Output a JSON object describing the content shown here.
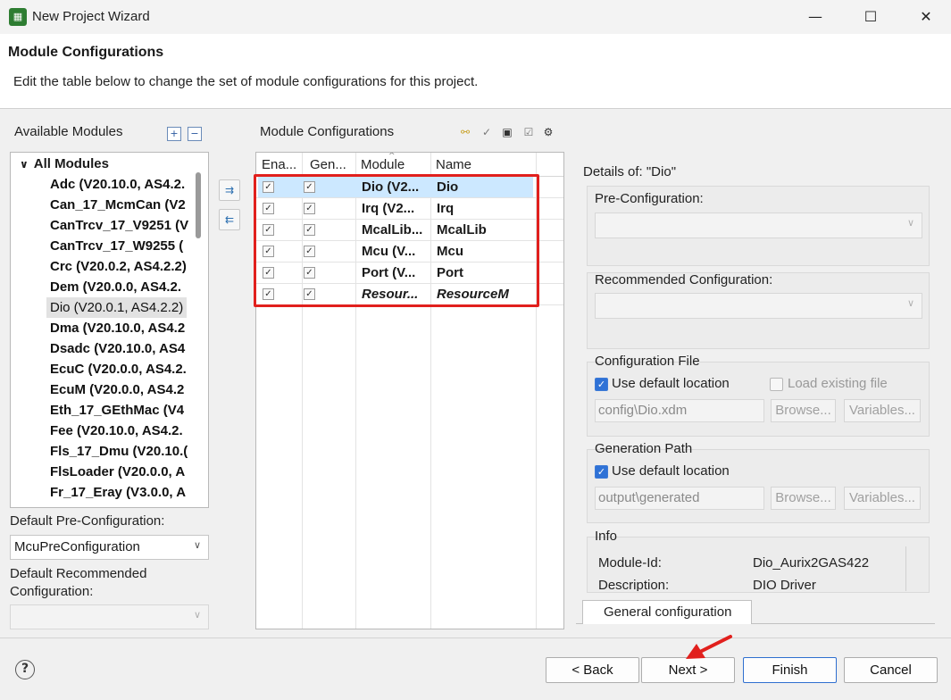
{
  "window": {
    "title": "New Project Wizard",
    "app_icon": "app-grid-icon"
  },
  "header": {
    "title": "Module Configurations",
    "description": "Edit the table below to change the set of module configurations for this project."
  },
  "available": {
    "label": "Available Modules",
    "root": "All Modules",
    "items": [
      "Adc (V20.10.0, AS4.2.",
      "Can_17_McmCan (V2",
      "CanTrcv_17_V9251 (V",
      "CanTrcv_17_W9255 (",
      "Crc (V20.0.2, AS4.2.2)",
      "Dem (V20.0.0, AS4.2.",
      "Dio (V20.0.1, AS4.2.2)",
      "Dma (V20.10.0, AS4.2",
      "Dsadc (V20.10.0, AS4",
      "EcuC (V20.0.0, AS4.2.",
      "EcuM (V20.0.0, AS4.2",
      "Eth_17_GEthMac (V4",
      "Fee (V20.10.0, AS4.2.",
      "Fls_17_Dmu (V20.10.(",
      "FlsLoader (V20.0.0, A",
      "Fr_17_Eray (V3.0.0, A"
    ],
    "selected_index": 6,
    "default_pre_label": "Default Pre-Configuration:",
    "default_pre_value": "McuPreConfiguration",
    "default_rec_label": "Default Recommended Configuration:",
    "default_rec_value": ""
  },
  "config": {
    "label": "Module Configurations",
    "columns": [
      "Ena...",
      "Gen...",
      "Module",
      "Name"
    ],
    "rows": [
      {
        "module": "Dio (V2...",
        "name": "Dio",
        "enabled": true,
        "generate": true,
        "italic": false,
        "selected": true
      },
      {
        "module": "Irq (V2...",
        "name": "Irq",
        "enabled": true,
        "generate": true,
        "italic": false,
        "selected": false
      },
      {
        "module": "McalLib...",
        "name": "McalLib",
        "enabled": true,
        "generate": true,
        "italic": false,
        "selected": false
      },
      {
        "module": "Mcu (V...",
        "name": "Mcu",
        "enabled": true,
        "generate": true,
        "italic": false,
        "selected": false
      },
      {
        "module": "Port (V...",
        "name": "Port",
        "enabled": true,
        "generate": true,
        "italic": false,
        "selected": false
      },
      {
        "module": "Resour...",
        "name": "ResourceM",
        "enabled": true,
        "generate": true,
        "italic": true,
        "selected": false
      }
    ]
  },
  "details": {
    "label": "Details of: \"Dio\"",
    "pre_config_label": "Pre-Configuration:",
    "pre_config_value": "",
    "rec_config_label": "Recommended Configuration:",
    "rec_config_value": "",
    "config_file_label": "Configuration File",
    "use_default_location": "Use default location",
    "load_existing": "Load existing file",
    "config_path": "config\\Dio.xdm",
    "browse": "Browse...",
    "variables": "Variables...",
    "gen_path_label": "Generation Path",
    "gen_use_default": "Use default location",
    "gen_path": "output\\generated",
    "info_label": "Info",
    "info_rows": [
      {
        "key": "Module-Id:",
        "value": "Dio_Aurix2GAS422"
      },
      {
        "key": "Description:",
        "value": "DIO Driver"
      }
    ],
    "tab": "General configuration"
  },
  "footer": {
    "help": "?",
    "back": "< Back",
    "next": "Next >",
    "finish": "Finish",
    "cancel": "Cancel"
  },
  "colors": {
    "highlight_box": "#e1201d",
    "selection": "#cce8ff",
    "accent": "#2f72d6"
  }
}
